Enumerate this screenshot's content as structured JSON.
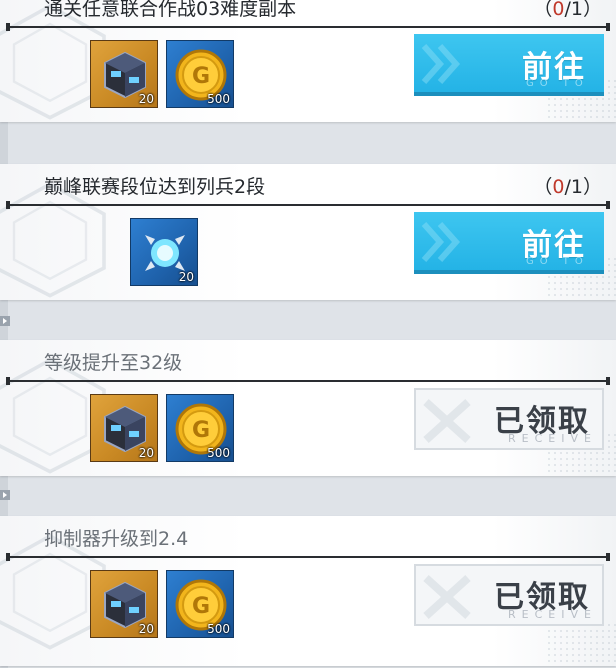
{
  "tasks": [
    {
      "title": "通关任意联合作战03难度副本",
      "progress_open": "（",
      "progress_current": "0",
      "progress_sep": "/1",
      "progress_close": "）",
      "rewards": [
        {
          "icon": "chip-cube-icon",
          "qty": "20",
          "bg": "orange"
        },
        {
          "icon": "gold-coin-icon",
          "qty": "500",
          "bg": "blue"
        }
      ],
      "button": {
        "state": "go",
        "label": "前往",
        "sub": "GO TO"
      }
    },
    {
      "title": "巅峰联赛段位达到列兵2段",
      "progress_open": "（",
      "progress_current": "0",
      "progress_sep": "/1",
      "progress_close": "）",
      "rewards": [
        {
          "icon": "energy-orb-icon",
          "qty": "20",
          "bg": "blue"
        }
      ],
      "button": {
        "state": "go",
        "label": "前往",
        "sub": "GO TO"
      }
    },
    {
      "title": "等级提升至32级",
      "rewards": [
        {
          "icon": "chip-cube-icon",
          "qty": "20",
          "bg": "orange"
        },
        {
          "icon": "gold-coin-icon",
          "qty": "500",
          "bg": "blue"
        }
      ],
      "button": {
        "state": "received",
        "label": "已领取",
        "sub": "RECEIVE"
      }
    },
    {
      "title": "抑制器升级到2.4",
      "rewards": [
        {
          "icon": "chip-cube-icon",
          "qty": "20",
          "bg": "orange"
        },
        {
          "icon": "gold-coin-icon",
          "qty": "500",
          "bg": "blue"
        }
      ],
      "button": {
        "state": "received",
        "label": "已领取",
        "sub": "RECEIVE"
      }
    }
  ],
  "colors": {
    "accent_go": "#24b3e6",
    "progress_current": "#c0392b",
    "reward_orange": "#c98924",
    "reward_blue": "#1f63ad"
  }
}
